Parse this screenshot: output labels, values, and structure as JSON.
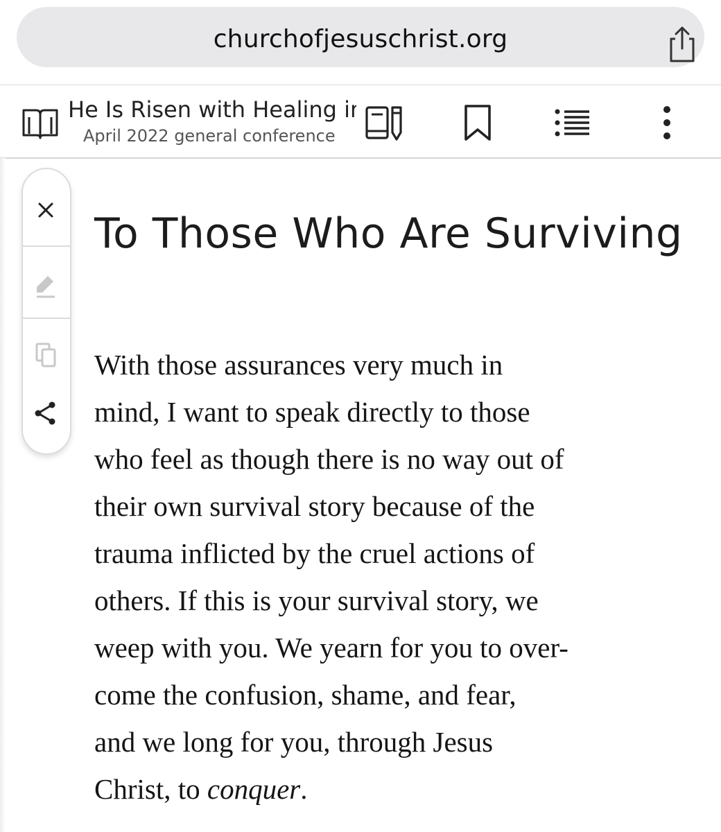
{
  "browser": {
    "url": "churchofjesuschrist.org",
    "share_icon": "share-icon"
  },
  "header": {
    "title": "He Is Risen with Healing in",
    "subtitle": "April 2022 general conference",
    "icons": {
      "library": "open-book-icon",
      "study_tools": "notebook-pencil-icon",
      "bookmark": "bookmark-icon",
      "contents": "list-icon",
      "more": "more-vertical-icon"
    }
  },
  "tool_rail": {
    "icons": [
      "close-icon",
      "highlighter-icon",
      "copy-icon",
      "share-icon"
    ]
  },
  "content": {
    "heading": "To Those Who Are Surviving",
    "paragraph": {
      "lines": [
        "With those assurances very much in",
        "mind, I want to speak directly to those",
        "who feel as though there is no way out of",
        "their own survival story because of the",
        "trauma inflicted by the cruel actions of",
        "others. If this is your survival story, we",
        "weep with you. We yearn for you to over-",
        "come the confusion, shame, and fear,",
        "and we long for you, through Jesus"
      ],
      "last_line_start": "Christ, to ",
      "last_line_emphasis": "conquer",
      "last_line_end": "."
    }
  },
  "colors": {
    "url_bar": "#e8e8ea",
    "text": "#151515",
    "divider": "#d6d6d6"
  }
}
